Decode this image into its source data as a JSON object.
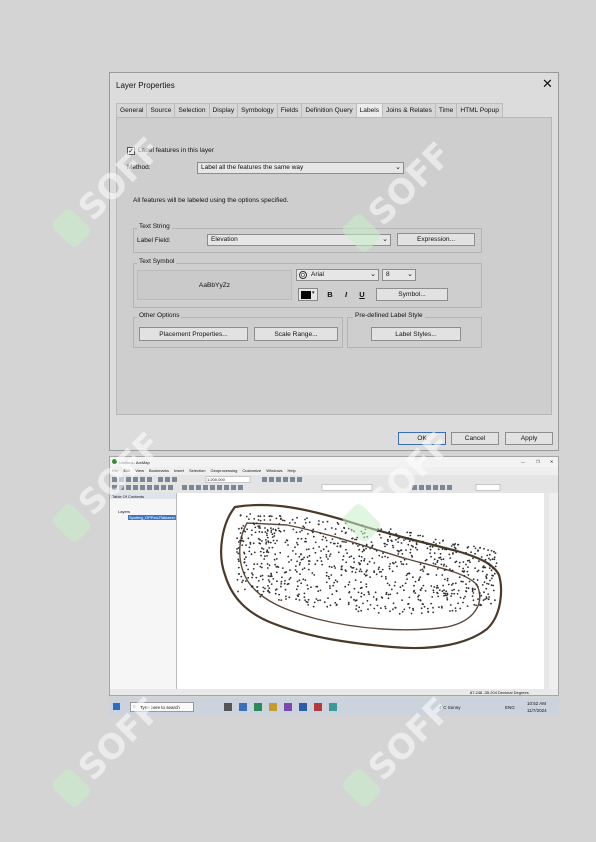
{
  "dialog": {
    "title": "Layer Properties",
    "close": "✕",
    "tabs": [
      "General",
      "Source",
      "Selection",
      "Display",
      "Symbology",
      "Fields",
      "Definition Query",
      "Labels",
      "Joins & Relates",
      "Time",
      "HTML Popup"
    ],
    "active_tab": "Labels",
    "label_features_checkbox": "Label features in this layer",
    "method_label": "Method:",
    "method_value": "Label all the features the same way",
    "info_text": "All features will be labeled using the options specified.",
    "text_string": {
      "group_label": "Text String",
      "field_label": "Label Field:",
      "field_value": "Elevation",
      "expression_button": "Expression..."
    },
    "text_symbol": {
      "group_label": "Text Symbol",
      "preview": "AaBbYyZz",
      "font": "Arial",
      "size": "8",
      "bold": "B",
      "italic": "I",
      "underline": "U",
      "symbol_button": "Symbol...",
      "color": "#000000"
    },
    "other_options": {
      "group_label": "Other Options",
      "placement_button": "Placement Properties...",
      "scale_button": "Scale Range..."
    },
    "label_style": {
      "group_label": "Pre-defined Label Style",
      "styles_button": "Label Styles..."
    },
    "buttons": {
      "ok": "OK",
      "cancel": "Cancel",
      "apply": "Apply"
    }
  },
  "arcmap": {
    "title": "Untitled - ArcMap",
    "window_controls": [
      "—",
      "❐",
      "✕"
    ],
    "menu": [
      "File",
      "Edit",
      "View",
      "Bookmarks",
      "Insert",
      "Selection",
      "Geoprocessing",
      "Customize",
      "Windows",
      "Help"
    ],
    "scale": "1:200,000",
    "toc_title": "Table Of Contents",
    "toc_layers": "Layers",
    "toc_layer_name": "Spotfeg_OPPeoJTablaesl",
    "status_coords": "87.248  -35.204 Decimal Degrees"
  },
  "taskbar": {
    "search_placeholder": "Type here to search",
    "weather": "4°C  Sunny",
    "lang": "ENG",
    "time": "10:52 AM",
    "date": "11/7/2024"
  },
  "watermark": {
    "text": "SOFF",
    "color": "#c8f0c8"
  }
}
